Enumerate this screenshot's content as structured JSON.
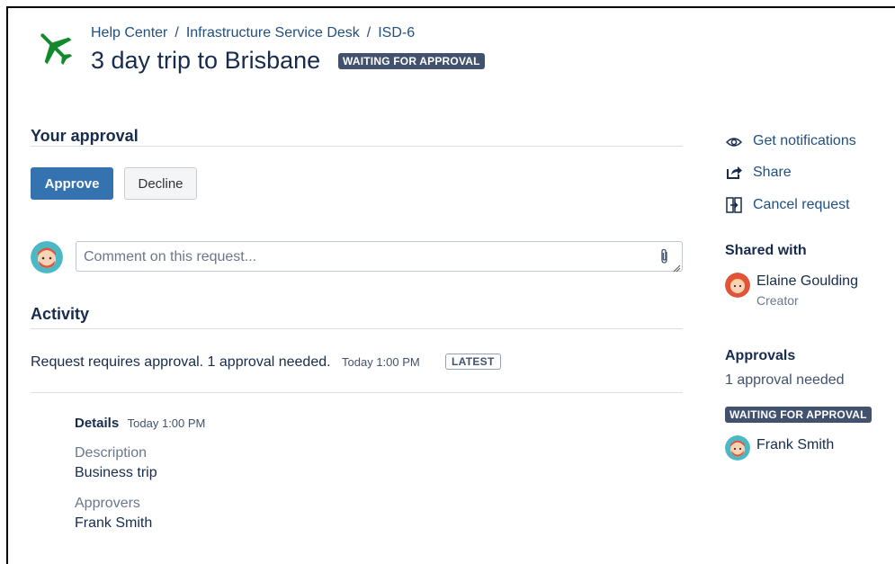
{
  "breadcrumb": {
    "items": [
      "Help Center",
      "Infrastructure Service Desk",
      "ISD-6"
    ],
    "separator": "/"
  },
  "request": {
    "title": "3 day trip to Brisbane",
    "status": "WAITING FOR APPROVAL"
  },
  "approval_section": {
    "heading": "Your approval",
    "approve_label": "Approve",
    "decline_label": "Decline"
  },
  "comment": {
    "placeholder": "Comment on this request...",
    "value": ""
  },
  "activity": {
    "heading": "Activity",
    "entry_text": "Request requires approval. 1 approval needed.",
    "entry_time": "Today 1:00 PM",
    "entry_badge": "LATEST",
    "details": {
      "label": "Details",
      "time": "Today 1:00 PM",
      "fields": [
        {
          "label": "Description",
          "value": "Business trip"
        },
        {
          "label": "Approvers",
          "value": "Frank Smith"
        }
      ]
    }
  },
  "sidebar": {
    "actions": [
      {
        "label": "Get notifications",
        "icon": "eye-icon"
      },
      {
        "label": "Share",
        "icon": "share-icon"
      },
      {
        "label": "Cancel request",
        "icon": "cancel-request-icon"
      }
    ],
    "shared_with": {
      "heading": "Shared with",
      "name": "Elaine Goulding",
      "role": "Creator"
    },
    "approvals": {
      "heading": "Approvals",
      "needed_text": "1 approval needed",
      "status": "WAITING FOR APPROVAL",
      "approver": "Frank Smith"
    }
  },
  "colors": {
    "accent": "#3572b0",
    "link": "#205081",
    "lozenge": "#42526e",
    "plane": "#14892c"
  }
}
